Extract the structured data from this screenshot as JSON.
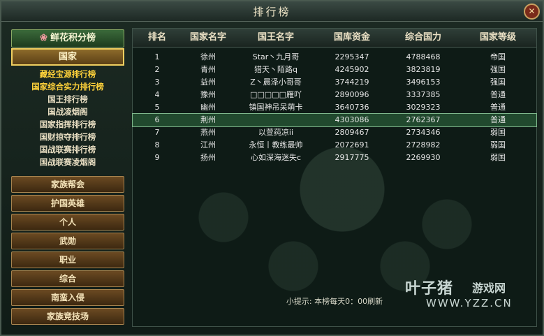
{
  "window": {
    "title": "排行榜",
    "close_label": "✕"
  },
  "sidebar": {
    "flower_ranking": "鲜花积分榜",
    "country": "国家",
    "sub_items": [
      "藏经宝源排行榜",
      "国家综合实力排行榜",
      "国王排行榜",
      "国战凌烟阁",
      "国家指挥排行榜",
      "国财掠夺排行榜",
      "国战联赛排行榜",
      "国战联赛凌烟阁"
    ],
    "buttons": [
      "家族帮会",
      "护国英雄",
      "个人",
      "武勋",
      "职业",
      "综合",
      "南蛮入侵",
      "家族竞技场"
    ]
  },
  "table": {
    "headers": [
      "排名",
      "国家名字",
      "国王名字",
      "国库资金",
      "综合国力",
      "国家等级"
    ],
    "rows": [
      [
        "1",
        "徐州",
        "Star丶九月哥",
        "2295347",
        "4788468",
        "帝国"
      ],
      [
        "2",
        "青州",
        "猎天丶陌路q",
        "4245902",
        "3823819",
        "强国"
      ],
      [
        "3",
        "益州",
        "Z丶晨泽小哥哥",
        "3744219",
        "3496153",
        "强国"
      ],
      [
        "4",
        "豫州",
        "□□□□□雁吖",
        "2890096",
        "3337385",
        "普通"
      ],
      [
        "5",
        "幽州",
        "镇国神吊呆萌卡",
        "3640736",
        "3029323",
        "普通"
      ],
      [
        "6",
        "荆州",
        "",
        "4303086",
        "2762367",
        "普通"
      ],
      [
        "7",
        "燕州",
        "以萱莼凉ii",
        "2809467",
        "2734346",
        "弱国"
      ],
      [
        "8",
        "江州",
        "永恒丨教练最帅",
        "2072691",
        "2728982",
        "弱国"
      ],
      [
        "9",
        "扬州",
        "心如深海迷失c",
        "2917775",
        "2269930",
        "弱国"
      ]
    ],
    "highlight_rank": "6"
  },
  "tip": "小提示: 本榜每天0：00刷新",
  "watermark": {
    "brand": "叶子猪",
    "subtitle": "游戏网",
    "url": "WWW.YZZ.CN"
  }
}
